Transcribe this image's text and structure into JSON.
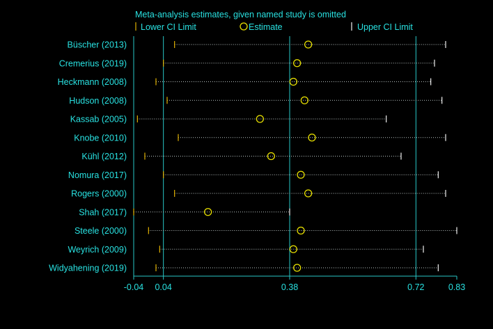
{
  "chart_data": {
    "type": "forest",
    "title": "Meta-analysis estimates, given named study is omitted",
    "legend": {
      "lower": "Lower CI Limit",
      "estimate": "Estimate",
      "upper": "Upper CI Limit",
      "placement": "top"
    },
    "xlim": [
      -0.04,
      0.83
    ],
    "x_ticks": [
      -0.04,
      0.04,
      0.38,
      0.72,
      0.83
    ],
    "x_tick_labels": [
      "-0.04",
      "0.04",
      "0.38",
      "0.72",
      "0.83"
    ],
    "reference_lines": [
      0.04,
      0.38,
      0.72
    ],
    "studies": [
      {
        "name": "Büscher (2013)",
        "lower": 0.07,
        "estimate": 0.43,
        "upper": 0.8
      },
      {
        "name": "Cremerius (2019)",
        "lower": 0.04,
        "estimate": 0.4,
        "upper": 0.77
      },
      {
        "name": "Heckmann (2008)",
        "lower": 0.02,
        "estimate": 0.39,
        "upper": 0.76
      },
      {
        "name": "Hudson (2008)",
        "lower": 0.05,
        "estimate": 0.42,
        "upper": 0.79
      },
      {
        "name": "Kassab (2005)",
        "lower": -0.03,
        "estimate": 0.3,
        "upper": 0.64
      },
      {
        "name": "Knobe (2010)",
        "lower": 0.08,
        "estimate": 0.44,
        "upper": 0.8
      },
      {
        "name": "Kühl (2012)",
        "lower": -0.01,
        "estimate": 0.33,
        "upper": 0.68
      },
      {
        "name": "Nomura (2017)",
        "lower": 0.04,
        "estimate": 0.41,
        "upper": 0.78
      },
      {
        "name": "Rogers (2000)",
        "lower": 0.07,
        "estimate": 0.43,
        "upper": 0.8
      },
      {
        "name": "Shah (2017)",
        "lower": -0.04,
        "estimate": 0.16,
        "upper": 0.38
      },
      {
        "name": "Steele (2000)",
        "lower": 0.0,
        "estimate": 0.41,
        "upper": 0.83
      },
      {
        "name": "Weyrich (2009)",
        "lower": 0.03,
        "estimate": 0.39,
        "upper": 0.74
      },
      {
        "name": "Widyahening (2019)",
        "lower": 0.02,
        "estimate": 0.4,
        "upper": 0.78
      }
    ],
    "colors": {
      "background": "#000000",
      "text": "#29e1e1",
      "reference_line": "#29c7c7",
      "ci_line": "#b9c4c4",
      "lower_mark": "#e0b000",
      "upper_mark": "#f2f2f2",
      "estimate": "#e8e000"
    }
  }
}
